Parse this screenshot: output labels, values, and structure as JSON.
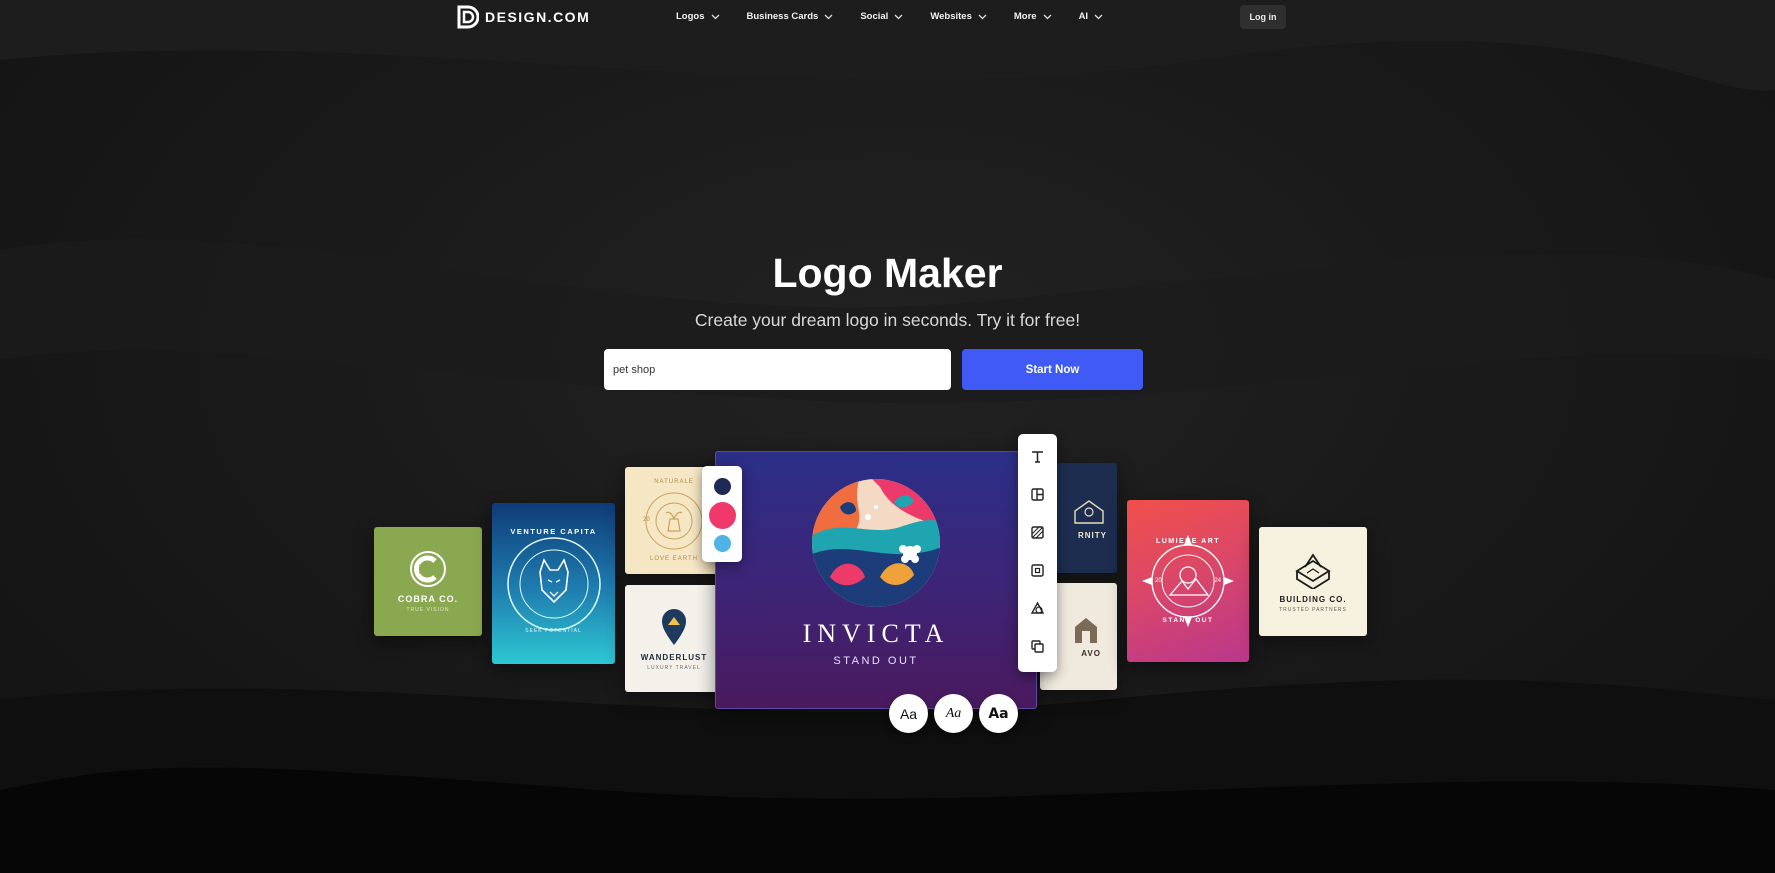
{
  "brand": {
    "name": "DESIGN.COM"
  },
  "nav": {
    "items": [
      {
        "label": "Logos"
      },
      {
        "label": "Business Cards"
      },
      {
        "label": "Social"
      },
      {
        "label": "Websites"
      },
      {
        "label": "More"
      },
      {
        "label": "AI"
      }
    ],
    "login_label": "Log in"
  },
  "hero": {
    "title": "Logo Maker",
    "subtitle": "Create your dream logo in seconds. Try it for free!",
    "search_value": "pet shop",
    "cta_label": "Start Now"
  },
  "cards": {
    "cobra": {
      "name": "COBRA CO.",
      "tagline": "TRUE VISION"
    },
    "venture": {
      "ring": "VENTURE CAPITA",
      "tagline": "SEEK POTENTIAL"
    },
    "naturale": {
      "ring": "NATURALE",
      "year": "20",
      "tagline": "LOVE EARTH"
    },
    "wanderlust": {
      "name": "WANDERLUST",
      "tagline": "LUXURY TRAVEL"
    },
    "invicta": {
      "name": "INVICTA",
      "tagline": "STAND OUT"
    },
    "serenity": {
      "name": "RNITY"
    },
    "bravo": {
      "name": "AVO"
    },
    "lumiere": {
      "ring": "LUMIERE ART",
      "left": "20",
      "right": "24",
      "tagline": "STAND OUT"
    },
    "building": {
      "name": "BUILDING CO.",
      "tagline": "TRUSTED PARTNERS"
    }
  },
  "editor": {
    "swatch_colors": [
      "#1e2a55",
      "#f0386b",
      "#4fb3e6"
    ],
    "tools": [
      "text-icon",
      "layout-icon",
      "background-icon",
      "frame-icon",
      "shape-icon",
      "layers-icon"
    ],
    "font_samples": [
      "Aa",
      "Aa",
      "Aa"
    ]
  },
  "colors": {
    "accent": "#3f5af5",
    "background": "#141414"
  }
}
